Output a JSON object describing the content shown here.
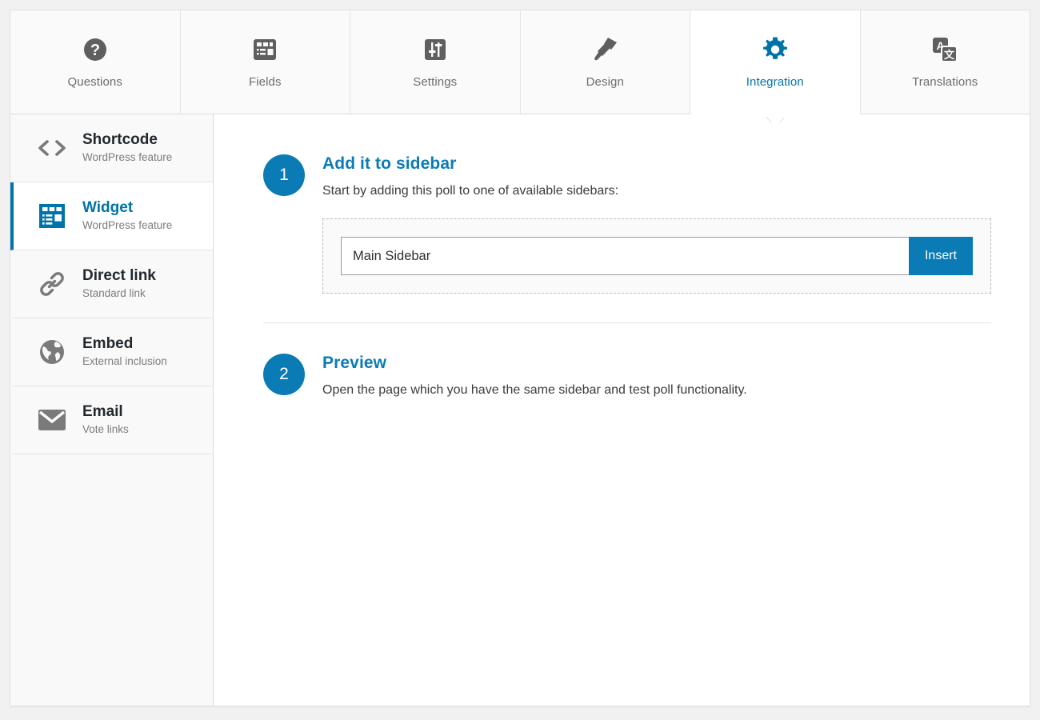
{
  "tabs": [
    {
      "label": "Questions",
      "icon": "question-mark-circle-icon",
      "active": false
    },
    {
      "label": "Fields",
      "icon": "form-fields-icon",
      "active": false
    },
    {
      "label": "Settings",
      "icon": "sliders-icon",
      "active": false
    },
    {
      "label": "Design",
      "icon": "paint-brush-icon",
      "active": false
    },
    {
      "label": "Integration",
      "icon": "gear-icon",
      "active": true
    },
    {
      "label": "Translations",
      "icon": "translate-icon",
      "active": false
    }
  ],
  "sidebar": {
    "items": [
      {
        "title": "Shortcode",
        "subtitle": "WordPress feature",
        "icon": "code-brackets-icon",
        "active": false
      },
      {
        "title": "Widget",
        "subtitle": "WordPress feature",
        "icon": "widget-icon",
        "active": true
      },
      {
        "title": "Direct link",
        "subtitle": "Standard link",
        "icon": "link-chain-icon",
        "active": false
      },
      {
        "title": "Embed",
        "subtitle": "External inclusion",
        "icon": "globe-icon",
        "active": false
      },
      {
        "title": "Email",
        "subtitle": "Vote links",
        "icon": "envelope-icon",
        "active": false
      }
    ]
  },
  "main": {
    "steps": [
      {
        "number": "1",
        "title": "Add it to sidebar",
        "description": "Start by adding this poll to one of available sidebars:"
      },
      {
        "number": "2",
        "title": "Preview",
        "description": "Open the page which you have the same sidebar and test poll functionality."
      }
    ],
    "sidebar_select": {
      "value": "Main Sidebar",
      "options": [
        "Main Sidebar"
      ]
    },
    "insert_button_label": "Insert"
  },
  "colors": {
    "accent_blue": "#0b7bb5",
    "tab_active_blue": "#0073aa",
    "icon_gray": "#5f5f5f",
    "page_bg": "#f1f1f1",
    "sidebar_bg": "#f9f9f9"
  }
}
